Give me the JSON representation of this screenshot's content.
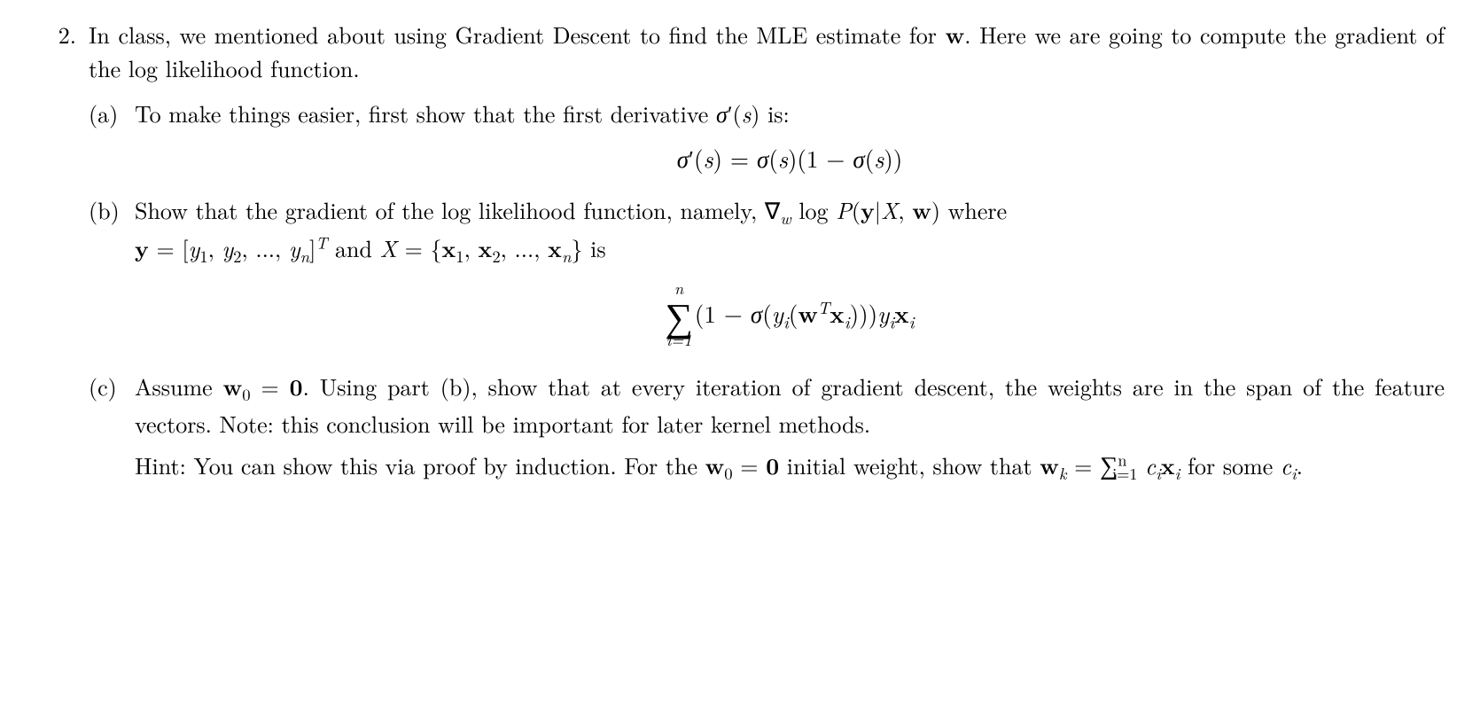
{
  "problem": {
    "number": "2.",
    "intro": "In class, we mentioned about using Gradient Descent to find the MLE estimate for <span class=\"bold\">w</span>. Here we are going to compute the gradient of the log likelihood function."
  },
  "parts": {
    "a": {
      "label": "(a)",
      "text": "To make things easier, first show that the first derivative <span class=\"ital\">σ</span>′(<span class=\"ital\">s</span>) is:",
      "equation": "<span class=\"ital\">σ</span>′(<span class=\"ital\">s</span>) = <span class=\"ital\">σ</span>(<span class=\"ital\">s</span>)(1 − <span class=\"ital\">σ</span>(<span class=\"ital\">s</span>))"
    },
    "b": {
      "label": "(b)",
      "line1": "Show that the gradient of the log likelihood function, namely, ∇<sub><span class=\"ital\">w</span></sub> log <span class=\"ital\">P</span>(<span class=\"bold\">y</span>|<span class=\"ital\">X</span>, <span class=\"bold\">w</span>) where",
      "line2": "<span class=\"bold\">y</span> = [<span class=\"ital\">y</span><sub>1</sub>, <span class=\"ital\">y</span><sub>2</sub>, ..., <span class=\"ital\">y</span><sub><span class=\"ital\">n</span></sub>]<span class=\"sup-T\">T</span> and <span class=\"ital\">X</span> = {<span class=\"bold\">x</span><sub>1</sub>, <span class=\"bold\">x</span><sub>2</sub>, ..., <span class=\"bold\">x</span><sub><span class=\"ital\">n</span></sub>} is",
      "sum_top": "n",
      "sum_bot": "i=1",
      "sum_body": "(1 − <span class=\"ital\">σ</span>(<span class=\"ital\">y</span><sub><span class=\"ital\">i</span></sub>(<span class=\"bold\">w</span><span class=\"sup-T\">T</span><span class=\"bold\">x</span><sub><span class=\"ital\">i</span></sub>)))<span class=\"ital\">y</span><sub><span class=\"ital\">i</span></sub><span class=\"bold\">x</span><sub><span class=\"ital\">i</span></sub>"
    },
    "c": {
      "label": "(c)",
      "para1": "Assume <span class=\"bold\">w</span><sub>0</sub> = <span class=\"bold\">0</span>. Using part (b), show that at every iteration of gradient descent, the weights are in the span of the feature vectors. Note: this conclusion will be important for later kernel methods.",
      "hint_pre": "Hint: You can show this via proof by induction. For the <span class=\"bold\">w</span><sub>0</sub> = <span class=\"bold\">0</span> initial weight, show that <span class=\"bold\">w</span><sub><span class=\"ital\">k</span></sub> = ",
      "hint_sum_top": "n",
      "hint_sum_bot": "i=1",
      "hint_sum_body": " <span class=\"ital\">c</span><sub><span class=\"ital\">i</span></sub><span class=\"bold\">x</span><sub><span class=\"ital\">i</span></sub>",
      "hint_post": " for some <span class=\"ital\">c</span><sub><span class=\"ital\">i</span></sub>."
    }
  }
}
